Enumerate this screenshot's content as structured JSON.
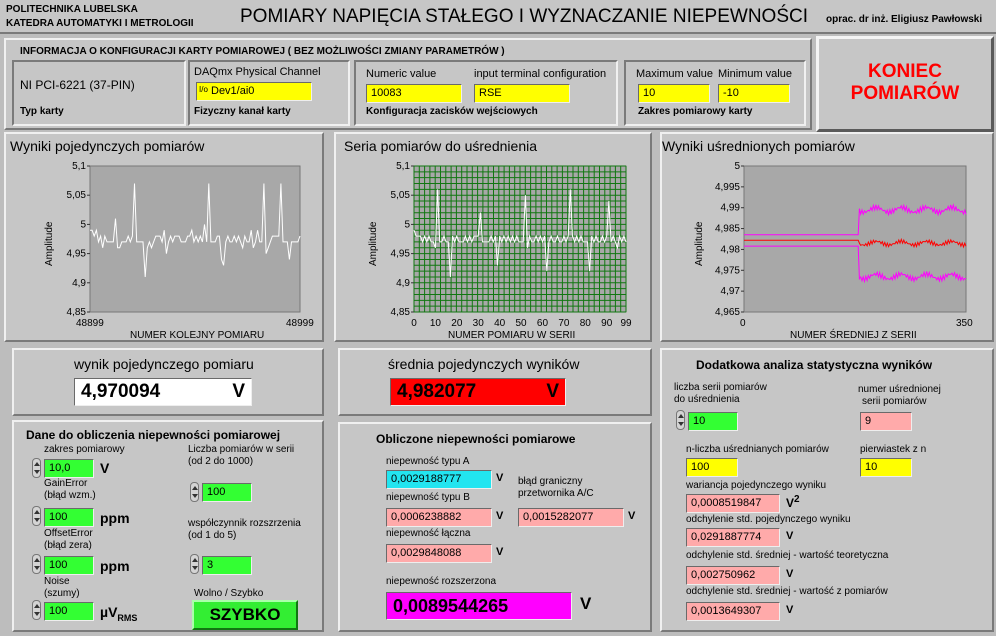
{
  "header": {
    "university": "POLITECHNIKA LUBELSKA",
    "department": "KATEDRA AUTOMATYKI I METROLOGII",
    "title": "POMIARY NAPIĘCIA STAŁEGO I WYZNACZANIE NIEPEWNOŚCI",
    "author": "oprac. dr inż. Eligiusz Pawłowski"
  },
  "config": {
    "heading": "INFORMACJA O KONFIGURACJI KARTY POMIAROWEJ ( BEZ MOŻLIWOŚCI ZMIANY PARAMETRÓW )",
    "card_name": "NI PCI-6221 (37-PIN)",
    "card_type_label": "Typ karty",
    "channel_label": "DAQmx Physical Channel",
    "channel_value": "Dev1/ai0",
    "channel_caption": "Fizyczny kanał karty",
    "numeric_label": "Numeric value",
    "numeric_value": "10083",
    "terminal_label": "input terminal configuration",
    "terminal_value": "RSE",
    "terminal_caption": "Konfiguracja zacisków wejściowych",
    "max_label": "Maximum value",
    "max_value": "10",
    "min_label": "Minimum value",
    "min_value": "-10",
    "range_caption": "Zakres pomiarowy karty"
  },
  "end_button": {
    "line1": "KONIEC",
    "line2": "POMIARÓW"
  },
  "charts": {
    "single": {
      "title": "Wyniki pojedynczych pomiarów",
      "ylabel": "Amplitude",
      "xlabel": "NUMER KOLEJNY POMIARU",
      "x_min": "48899",
      "x_max": "48999",
      "yticks": [
        "5,1",
        "5,05",
        "5",
        "4,95",
        "4,9",
        "4,85"
      ]
    },
    "series": {
      "title": "Seria pomiarów do uśrednienia",
      "ylabel": "Amplitude",
      "xlabel": "NUMER POMIARU W SERII",
      "yticks": [
        "5,1",
        "5,05",
        "5",
        "4,95",
        "4,9",
        "4,85"
      ],
      "xticks": [
        "0",
        "10",
        "20",
        "30",
        "40",
        "50",
        "60",
        "70",
        "80",
        "90",
        "99"
      ]
    },
    "averaged": {
      "title": "Wyniki uśrednionych pomiarów",
      "ylabel": "Amplitude",
      "xlabel": "NUMER ŚREDNIEJ Z SERII",
      "x_min": "0",
      "x_max": "350",
      "yticks": [
        "5",
        "4,995",
        "4,99",
        "4,985",
        "4,98",
        "4,975",
        "4,97",
        "4,965"
      ]
    }
  },
  "chart_data": [
    {
      "type": "line",
      "title": "Wyniki pojedynczych pomiarów",
      "xlabel": "NUMER KOLEJNY POMIARU",
      "ylabel": "Amplitude",
      "xlim": [
        48899,
        48999
      ],
      "ylim": [
        4.85,
        5.1
      ],
      "series": [
        {
          "values": [
            4.99,
            4.99,
            4.98,
            4.99,
            4.97,
            4.98,
            4.96,
            4.98,
            4.97,
            4.97,
            4.97,
            4.97,
            5.01,
            4.96,
            4.96,
            4.97,
            4.97,
            4.97,
            4.98,
            4.97,
            4.98,
            5.07,
            4.97,
            4.97,
            4.97,
            4.97,
            4.91,
            4.96,
            4.97,
            4.96,
            4.97,
            4.98,
            4.98,
            4.98,
            4.97,
            4.99,
            4.95,
            4.97,
            4.98,
            4.97,
            4.98,
            4.98,
            4.98,
            4.97,
            4.97,
            4.97,
            4.98,
            4.98,
            4.99,
            4.97,
            4.98,
            4.97,
            4.98,
            4.97,
            5.0,
            4.97,
            5.07,
            4.97,
            4.97,
            4.97,
            4.98,
            4.98,
            4.94,
            4.93,
            4.97,
            4.98,
            4.97,
            4.97,
            4.98,
            4.97,
            4.98,
            4.97,
            4.96,
            4.98,
            4.97,
            4.97,
            4.99,
            4.96,
            4.97,
            4.99,
            4.97,
            4.97,
            5.07,
            4.95,
            4.96,
            4.97,
            4.98,
            4.98,
            4.98,
            4.98,
            5.07,
            4.97,
            4.97,
            4.97,
            4.94,
            4.97,
            4.97,
            4.97,
            4.97,
            4.98
          ]
        }
      ]
    },
    {
      "type": "line",
      "title": "Seria pomiarów do uśrednienia",
      "xlabel": "NUMER POMIARU W SERII",
      "ylabel": "Amplitude",
      "xlim": [
        0,
        99
      ],
      "ylim": [
        4.85,
        5.1
      ],
      "series": [
        {
          "values": [
            4.99,
            4.98,
            4.98,
            4.98,
            4.97,
            4.98,
            4.97,
            4.98,
            4.97,
            4.97,
            4.96,
            5.06,
            4.97,
            4.97,
            4.98,
            4.97,
            4.97,
            4.91,
            4.98,
            4.97,
            4.98,
            4.97,
            4.97,
            4.97,
            4.98,
            4.97,
            4.98,
            4.97,
            4.98,
            4.98,
            4.98,
            5.02,
            4.97,
            4.97,
            4.97,
            4.97,
            4.98,
            4.97,
            4.98,
            4.93,
            4.98,
            4.97,
            4.98,
            4.97,
            4.98,
            4.97,
            4.98,
            4.97,
            4.98,
            4.97,
            4.97,
            4.97,
            5.05,
            4.96,
            4.98,
            4.97,
            4.97,
            4.98,
            4.97,
            4.98,
            4.97,
            4.98,
            4.92,
            4.97,
            4.98,
            4.97,
            4.97,
            4.98,
            4.97,
            4.97,
            4.98,
            4.97,
            4.98,
            5.06,
            4.98,
            4.97,
            4.98,
            4.97,
            4.98,
            4.97,
            4.97,
            4.97,
            4.92,
            4.98,
            4.97,
            4.98,
            4.97,
            4.97,
            4.98,
            4.97,
            4.98,
            5.04,
            4.97,
            4.98,
            4.97,
            4.96,
            4.98,
            4.97,
            4.98,
            4.97
          ]
        }
      ]
    },
    {
      "type": "line",
      "title": "Wyniki uśrednionych pomiarów",
      "xlabel": "NUMER ŚREDNIEJ Z SERII",
      "ylabel": "Amplitude",
      "xlim": [
        0,
        350
      ],
      "ylim": [
        4.965,
        5.0
      ],
      "series": [
        {
          "name": "upper",
          "color": "#ff00ff",
          "points": [
            [
              0,
              4.9835
            ],
            [
              180,
              4.9835
            ],
            [
              185,
              4.9895
            ],
            [
              350,
              4.9895
            ]
          ]
        },
        {
          "name": "mean",
          "color": "#ff0000",
          "points": [
            [
              0,
              4.9822
            ],
            [
              180,
              4.9822
            ],
            [
              185,
              4.9815
            ],
            [
              350,
              4.9815
            ]
          ]
        },
        {
          "name": "lower",
          "color": "#ff00ff",
          "points": [
            [
              0,
              4.9808
            ],
            [
              180,
              4.9808
            ],
            [
              185,
              4.9735
            ],
            [
              350,
              4.9735
            ]
          ]
        }
      ]
    }
  ],
  "single": {
    "label": "wynik pojedynczego pomiaru",
    "value": "4,970094",
    "unit": "V"
  },
  "average": {
    "label": "średnia pojedynczych wyników",
    "value": "4,982077",
    "unit": "V"
  },
  "input": {
    "heading": "Dane do obliczenia niepewności pomiarowej",
    "range_label": "zakres pomiarowy",
    "range_value": "10,0",
    "range_unit": "V",
    "gain_label1": "GainError",
    "gain_label2": "(błąd wzm.)",
    "gain_value": "100",
    "gain_unit": "ppm",
    "offset_label1": "OffsetError",
    "offset_label2": "(błąd zera)",
    "offset_value": "100",
    "offset_unit": "ppm",
    "noise_label1": "Noise",
    "noise_label2": "(szumy)",
    "noise_value": "100",
    "noise_unit": "µV",
    "noise_unit_sub": "RMS",
    "count_label1": "Liczba pomiarów w serii",
    "count_label2": "(od 2 do 1000)",
    "count_value": "100",
    "coef_label1": "współczynnik rozszrzenia",
    "coef_label2": "(od 1 do 5)",
    "coef_value": "3",
    "speed_label": "Wolno / Szybko",
    "speed_value": "SZYBKO"
  },
  "uncertainty": {
    "heading": "Obliczone niepewności pomiarowe",
    "typeA_label": "niepewność typu A",
    "typeA_value": "0,0029188777",
    "typeB_label": "niepewność typu B",
    "typeB_value": "0,0006238882",
    "total_label": "niepewność łączna",
    "total_value": "0,0029848088",
    "adc_label1": "błąd graniczny",
    "adc_label2": "przetwornika A/C",
    "adc_value": "0,0015282077",
    "expanded_label": "niepewność rozszerzona",
    "expanded_value": "0,0089544265",
    "unit": "V"
  },
  "stats": {
    "heading": "Dodatkowa analiza statystyczna wyników",
    "series_count_label1": "liczba serii pomiarów",
    "series_count_label2": "do uśrednienia",
    "series_count_value": "10",
    "avg_index_label1": "numer uśrednionej",
    "avg_index_label2": "serii pomiarów",
    "avg_index_value": "9",
    "n_label": "n-liczba uśrednianych pomiarów",
    "n_value": "100",
    "sqrt_label": "pierwiastek z n",
    "sqrt_value": "10",
    "variance_label": "wariancja pojedynczego wyniku",
    "variance_value": "0,0008519847",
    "variance_unit": "V",
    "variance_exp": "2",
    "std_single_label": "odchylenie std. pojedynczego wyniku",
    "std_single_value": "0,0291887774",
    "std_theor_label": "odchylenie std. średniej - wartość teoretyczna",
    "std_theor_value": "0,002750962",
    "std_meas_label": "odchylenie std. średniej - wartość z pomiarów",
    "std_meas_value": "0,0013649307",
    "unit": "V"
  }
}
